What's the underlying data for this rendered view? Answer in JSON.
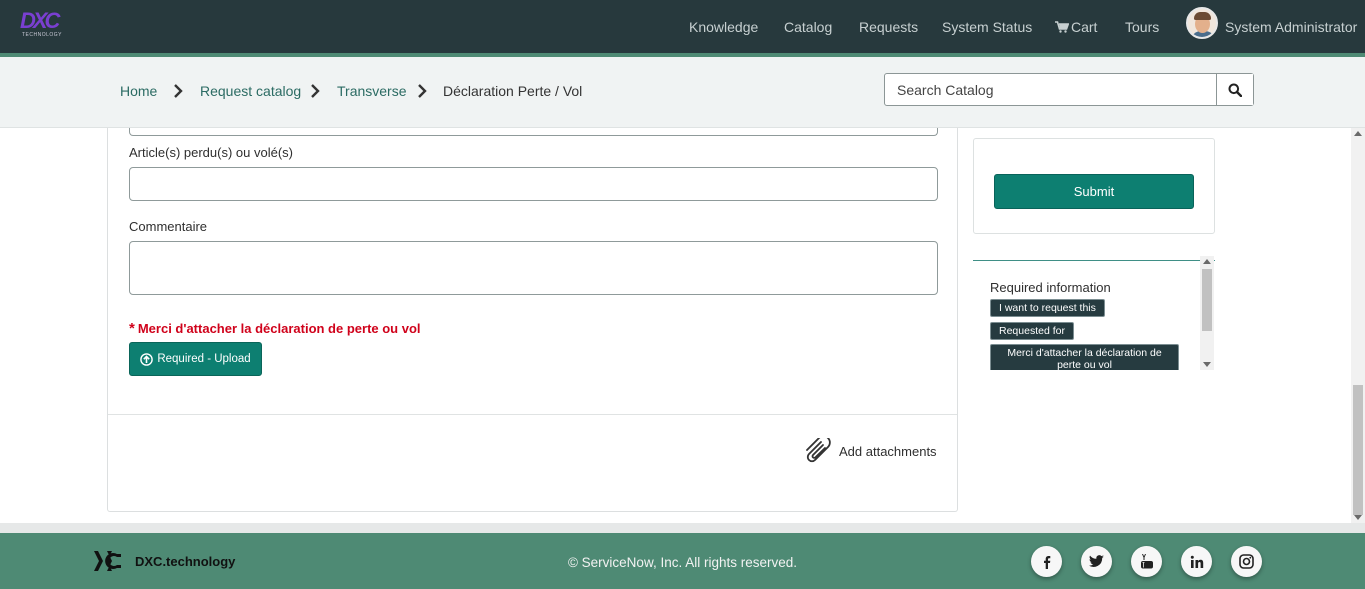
{
  "header": {
    "logo_text": "DXC",
    "logo_sub": "TECHNOLOGY",
    "nav": [
      "Knowledge",
      "Catalog",
      "Requests",
      "System Status",
      "Cart",
      "Tours"
    ],
    "user_name": "System Administrator"
  },
  "breadcrumb": {
    "items": [
      "Home",
      "Request catalog",
      "Transverse",
      "Déclaration Perte / Vol"
    ]
  },
  "search": {
    "placeholder": "Search Catalog"
  },
  "form": {
    "article_label": "Article(s) perdu(s) ou volé(s)",
    "article_value": "",
    "comment_label": "Commentaire",
    "comment_value": "",
    "required_star": "*",
    "required_message": "Merci d'attacher la déclaration de perte ou vol",
    "upload_label": "Required - Upload",
    "attachments_label": "Add attachments"
  },
  "sidebar": {
    "submit_label": "Submit",
    "required_title": "Required information",
    "required_items": [
      "I want to request this",
      "Requested for",
      "Merci d'attacher la déclaration de perte ou vol"
    ]
  },
  "footer": {
    "brand": "DXC.technology",
    "copyright": "© ServiceNow, Inc. All rights reserved.",
    "social": [
      "facebook-icon",
      "twitter-icon",
      "youtube-icon",
      "linkedin-icon",
      "instagram-icon"
    ]
  },
  "colors": {
    "header_bg": "#27393d",
    "accent_green": "#0d7f71",
    "footer_bg": "#4e8a74",
    "required_red": "#d0021b"
  }
}
